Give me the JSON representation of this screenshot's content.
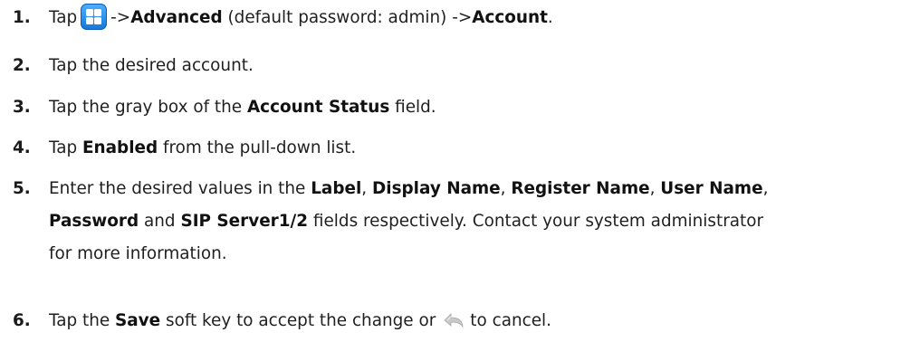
{
  "steps": [
    {
      "num": "1.",
      "t1": "Tap",
      "icon": "menu-grid-icon",
      "t2": "->",
      "b1": "Advanced",
      "t3": " (default password: admin) ->",
      "b2": "Account",
      "t4": "."
    },
    {
      "num": "2.",
      "t1": "Tap the desired account."
    },
    {
      "num": "3.",
      "t1": "Tap the gray box of the ",
      "b1": "Account Status",
      "t2": " field."
    },
    {
      "num": "4.",
      "t1": "Tap ",
      "b1": "Enabled",
      "t2": " from the pull-down list."
    },
    {
      "num": "5.",
      "t1": "Enter the desired values in the ",
      "b1": "Label",
      "t2": ", ",
      "b2": "Display Name",
      "t3": ", ",
      "b3": "Register Name",
      "t4": ", ",
      "b4": "User Name",
      "t5": ",",
      "b5": "Password",
      "t6": " and ",
      "b6": "SIP Server1/2",
      "t7": " fields respectively. Contact your system administrator",
      "t8": "for more information."
    },
    {
      "num": "6.",
      "t1": "Tap the ",
      "b1": "Save",
      "t2": " soft key to accept the change or",
      "icon": "back-arrow-icon",
      "t3": "to cancel."
    }
  ]
}
